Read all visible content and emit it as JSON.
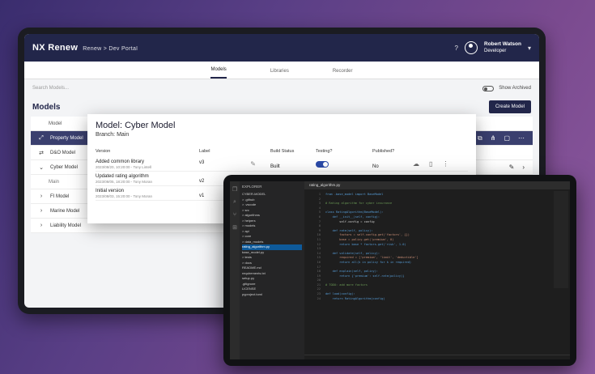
{
  "header": {
    "brand": "NX Renew",
    "breadcrumb": "Renew > Dev Portal",
    "user_name": "Robert Watson",
    "user_role": "Developer"
  },
  "tabs": [
    {
      "label": "Models"
    },
    {
      "label": "Libraries"
    },
    {
      "label": "Recorder"
    }
  ],
  "search": {
    "placeholder": "Search Models...",
    "toggle_label": "Show Archived"
  },
  "models": {
    "title": "Models",
    "create_label": "Create Model",
    "column_header": "Model",
    "rows": [
      {
        "label": "Property Model"
      },
      {
        "label": "D&O Model"
      },
      {
        "label": "Cyber Model"
      },
      {
        "label": "Main"
      },
      {
        "label": "FI Model"
      },
      {
        "label": "Marine Model"
      },
      {
        "label": "Liability Model"
      }
    ]
  },
  "modal": {
    "title": "Model: Cyber Model",
    "subtitle": "Branch: Main",
    "headers": {
      "version": "Version",
      "label": "Label",
      "build_status": "Build Status",
      "testing": "Testing?",
      "published": "Published?"
    },
    "rows": [
      {
        "title": "Added common library",
        "meta": "2023/08/20, 10:20:00 - Tony Lintell",
        "label": "v3",
        "build": "Built",
        "published": "No"
      },
      {
        "title": "Updated rating algorithm",
        "meta": "2023/08/05, 18:20:00 - Tony Moran",
        "label": "v2",
        "build": "",
        "published": ""
      },
      {
        "title": "Initial version",
        "meta": "2023/08/03, 15:20:00 - Tony Moran",
        "label": "v1",
        "build": "",
        "published": ""
      }
    ]
  },
  "ide": {
    "explorer_title": "EXPLORER",
    "open_file": "rating_algorithm.py",
    "tree": [
      "CYBER-MODEL",
      "> .github",
      "> .vscode",
      "  > src",
      "    > algorithms",
      "      > helpers",
      "      > models",
      "    > api",
      "    > core",
      "    > data_models",
      "      rating_algorithm.py",
      "      base_model.py",
      "  > tests",
      "  > docs",
      "    README.md",
      "  requirements.txt",
      "  setup.py",
      "  .gitignore",
      "  LICENSE",
      "  pyproject.toml"
    ],
    "code": [
      "from .base_model import BaseModel",
      "",
      "# Rating algorithm for cyber insurance",
      "",
      "class RatingAlgorithm(BaseModel):",
      "    def __init__(self, config):",
      "        self.config = config",
      "",
      "    def rate(self, policy):",
      "        factors = self.config.get('factors', {})",
      "        base = policy.get('premium', 0)",
      "        return base * factors.get('risk', 1.0)",
      "",
      "    def validate(self, policy):",
      "        required = ['premium', 'limit', 'deductible']",
      "        return all(k in policy for k in required)",
      "",
      "    def explain(self, policy):",
      "        return {'premium': self.rate(policy)}",
      "",
      "# TODO: add more factors",
      "",
      "def load(config):",
      "    return RatingAlgorithm(config)"
    ]
  }
}
